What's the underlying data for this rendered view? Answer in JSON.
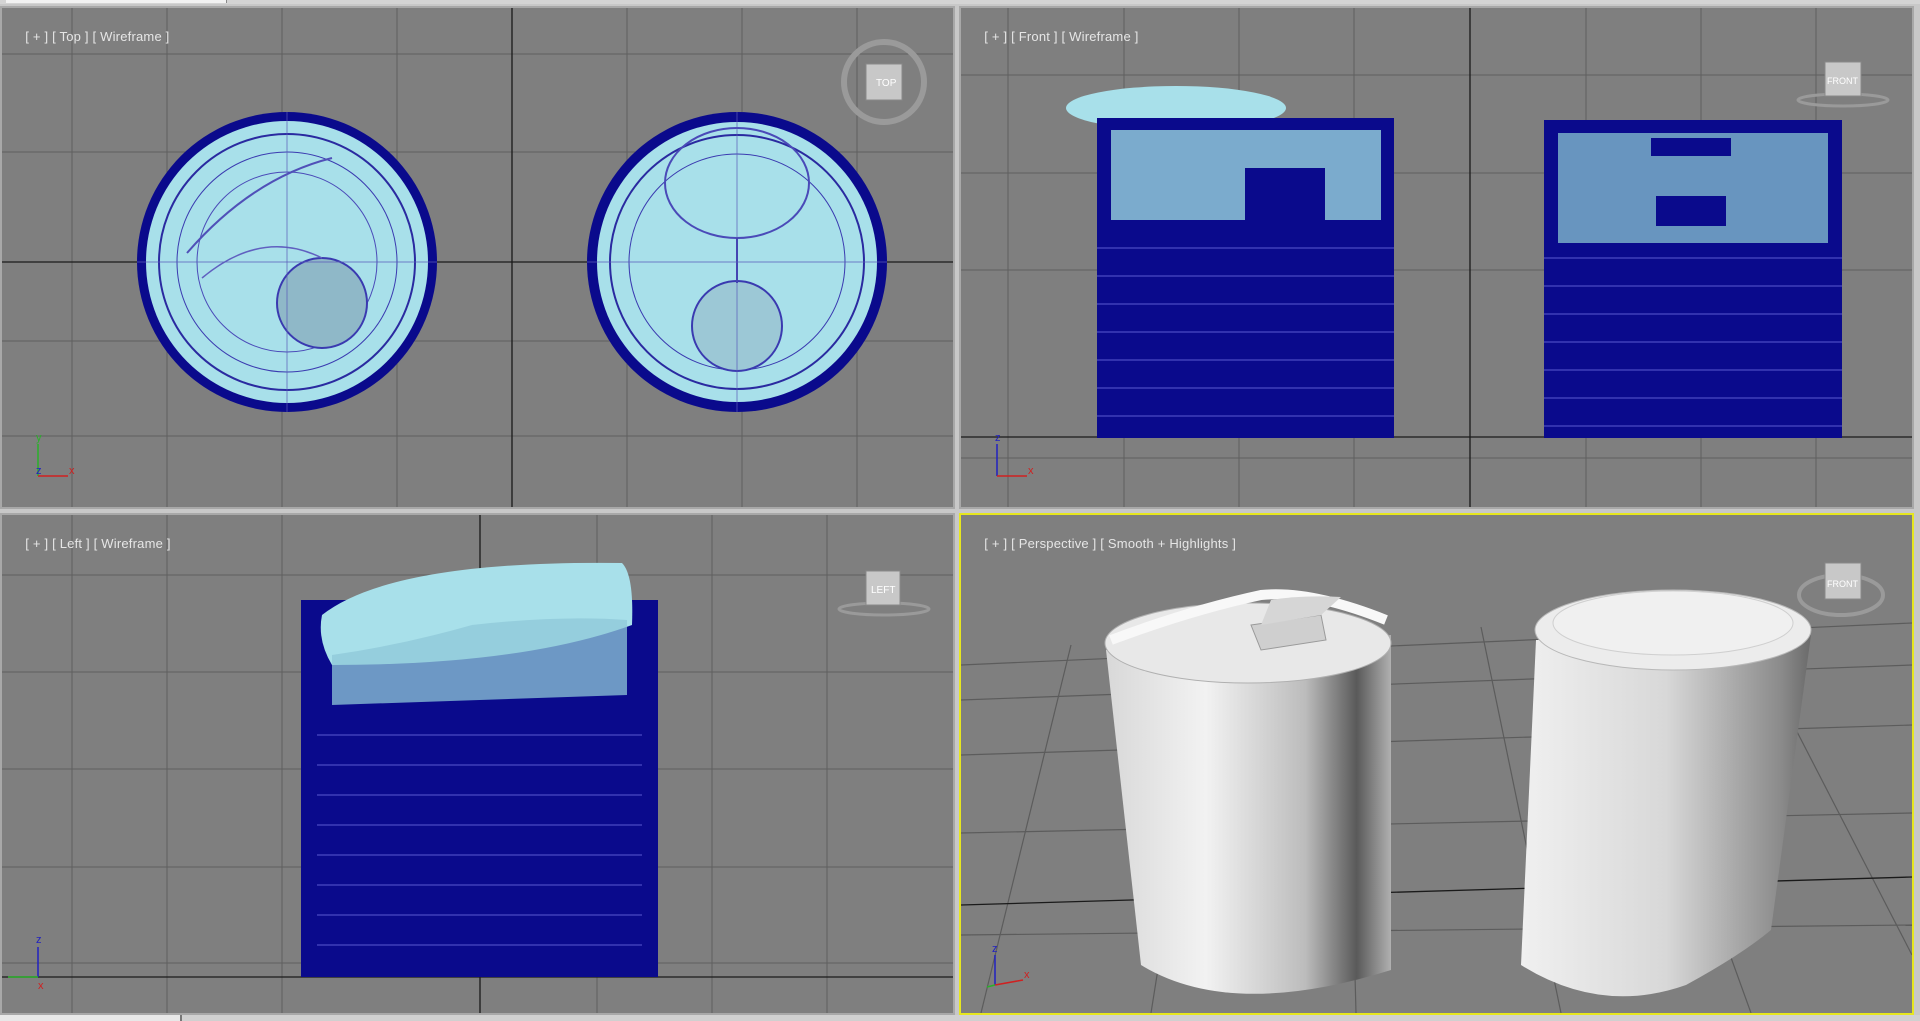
{
  "viewports": {
    "top": {
      "plus": "[ + ]",
      "view": "[ Top ]",
      "mode": "[ Wireframe ]",
      "cube_label": "TOP"
    },
    "front": {
      "plus": "[ + ]",
      "view": "[ Front ]",
      "mode": "[ Wireframe ]",
      "cube_label": "FRONT"
    },
    "left": {
      "plus": "[ + ]",
      "view": "[ Left ]",
      "mode": "[ Wireframe ]",
      "cube_label": "LEFT"
    },
    "perspective": {
      "plus": "[ + ]",
      "view": "[ Perspective ]",
      "mode": "[ Smooth + Highlights ]",
      "cube_label": "FRONT"
    }
  },
  "axes": {
    "x": "x",
    "y": "y",
    "z": "z"
  },
  "colors": {
    "viewport_bg": "#7f7f7f",
    "grid": "#5f5f5f",
    "grid_axis": "#1a1a1a",
    "wire_dark": "#0a0a8c",
    "wire_light": "#a8e0ea",
    "active_border": "#e6e61f"
  }
}
